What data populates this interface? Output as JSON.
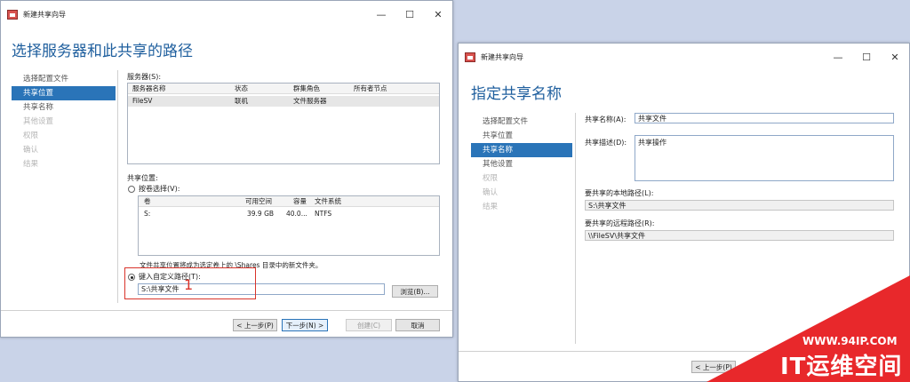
{
  "window_left": {
    "title": "新建共享向导",
    "controls": {
      "minimize": "—",
      "maximize": "☐",
      "close": "✕"
    },
    "heading": "选择服务器和此共享的路径",
    "nav": [
      {
        "label": "选择配置文件",
        "state": "normal"
      },
      {
        "label": "共享位置",
        "state": "active"
      },
      {
        "label": "共享名称",
        "state": "normal"
      },
      {
        "label": "其他设置",
        "state": "disabled"
      },
      {
        "label": "权限",
        "state": "disabled"
      },
      {
        "label": "确认",
        "state": "disabled"
      },
      {
        "label": "结果",
        "state": "disabled"
      }
    ],
    "server_label": "服务器(S):",
    "server_columns": [
      "服务器名称",
      "状态",
      "群集角色",
      "所有者节点"
    ],
    "server_rows": [
      {
        "name": "FileSV",
        "status": "联机",
        "role": "文件服务器",
        "owner": ""
      }
    ],
    "share_location_label": "共享位置:",
    "by_volume_label": "按卷选择(V):",
    "volume_columns": [
      "卷",
      "可用空间",
      "容量",
      "文件系统"
    ],
    "volume_rows": [
      {
        "vol": "S:",
        "free": "39.9 GB",
        "capacity": "40.0...",
        "fs": "NTFS"
      }
    ],
    "volume_note": "文件共享位置将成为选定卷上的 \\Shares 目录中的新文件夹。",
    "custom_path_label": "键入自定义路径(T):",
    "custom_path_value": "S:\\共享文件",
    "browse_button": "浏览(B)...",
    "annotation_number": "1",
    "buttons": {
      "prev": "< 上一步(P)",
      "next": "下一步(N) >",
      "create": "创建(C)",
      "cancel": "取消"
    }
  },
  "window_right": {
    "title": "新建共享向导",
    "controls": {
      "minimize": "—",
      "maximize": "☐",
      "close": "✕"
    },
    "heading": "指定共享名称",
    "nav": [
      {
        "label": "选择配置文件",
        "state": "normal"
      },
      {
        "label": "共享位置",
        "state": "normal"
      },
      {
        "label": "共享名称",
        "state": "active"
      },
      {
        "label": "其他设置",
        "state": "normal"
      },
      {
        "label": "权限",
        "state": "disabled"
      },
      {
        "label": "确认",
        "state": "disabled"
      },
      {
        "label": "结果",
        "state": "disabled"
      }
    ],
    "share_name_label": "共享名称(A):",
    "share_name_value": "共享文件",
    "share_desc_label": "共享描述(D):",
    "share_desc_value": "共享操作",
    "local_path_label": "要共享的本地路径(L):",
    "local_path_value": "S:\\共享文件",
    "remote_path_label": "要共享的远程路径(R):",
    "remote_path_value": "\\\\FileSV\\共享文件",
    "buttons": {
      "prev": "< 上一步(P)"
    }
  },
  "watermark": {
    "url": "WWW.94IP.COM",
    "text": "IT运维空间",
    "color": "#e8282b"
  }
}
